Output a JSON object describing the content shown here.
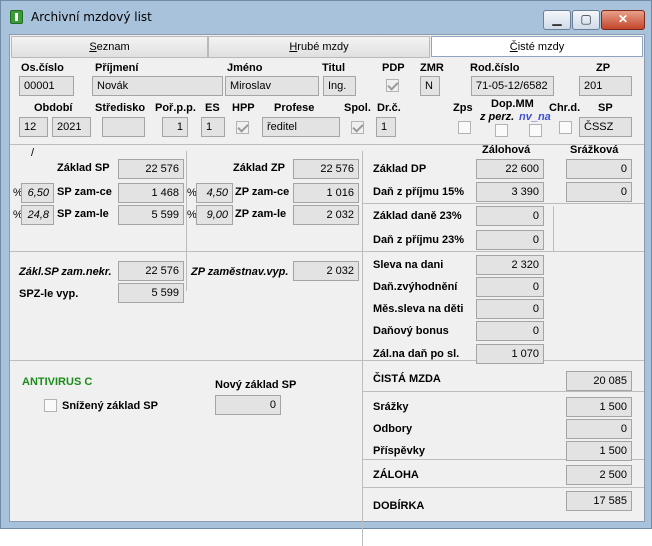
{
  "window": {
    "title": "Archivní mzdový list"
  },
  "tabs": [
    "Seznam",
    "Hrubé mzdy",
    "Čisté mzdy"
  ],
  "tabs_underline": [
    "S",
    "H",
    "Č"
  ],
  "tabs_rest": [
    "eznam",
    "rubé mzdy",
    "isté mzdy"
  ],
  "header": {
    "os_cislo": {
      "label": "Os.číslo",
      "value": "00001"
    },
    "prijmeni": {
      "label": "Příjmení",
      "value": "Novák"
    },
    "jmeno": {
      "label": "Jméno",
      "value": "Miroslav"
    },
    "titul": {
      "label": "Titul",
      "value": "Ing."
    },
    "pdp": {
      "label": "PDP",
      "checked": true
    },
    "zmr": {
      "label": "ZMR",
      "value": "N"
    },
    "rod_cislo": {
      "label": "Rod.číslo",
      "value": "71-05-12/6582"
    },
    "zp": {
      "label": "ZP",
      "value": "201"
    },
    "obdobi": {
      "label": "Období",
      "month": "12",
      "year": "2021"
    },
    "stredisko": {
      "label": "Středisko",
      "value": ""
    },
    "por_pp": {
      "label": "Poř.p.p.",
      "value": "1"
    },
    "es": {
      "label": "ES",
      "value": "1"
    },
    "hpp": {
      "label": "HPP",
      "checked": true
    },
    "profese": {
      "label": "Profese",
      "value": "ředitel"
    },
    "spol": {
      "label": "Spol.",
      "checked": true
    },
    "dr_c": {
      "label": "Dr.č.",
      "value": "1"
    },
    "zps": {
      "label": "Zps",
      "checked": false
    },
    "dop_mm": {
      "label": "Dop.MM",
      "sub_label": "z perz.",
      "sub_value": "nv_na",
      "checked": false
    },
    "chr_d": {
      "label": "Chr.d.",
      "checked": false
    },
    "sp": {
      "label": "SP",
      "value": "ČSSZ"
    }
  },
  "social": {
    "marker": "/",
    "zaklad_sp": {
      "label": "Základ SP",
      "value": "22 576"
    },
    "sp_zam_ce": {
      "label": "SP zam-ce",
      "pct": "6,50",
      "value": "1 468"
    },
    "sp_zam_le": {
      "label": "SP zam-le",
      "pct": "24,8",
      "value": "5 599"
    },
    "pct_sign": "%",
    "zakl_sp_zam_nekr": {
      "label": "Zákl.SP zam.nekr.",
      "value": "22 576"
    },
    "spz_le_vyp": {
      "label": "SPZ-le vyp.",
      "value": "5 599"
    }
  },
  "health": {
    "zaklad_zp": {
      "label": "Základ ZP",
      "value": "22 576"
    },
    "zp_zam_ce": {
      "label": "ZP zam-ce",
      "pct": "4,50",
      "value": "1 016"
    },
    "zp_zam_le": {
      "label": "ZP zam-le",
      "pct": "9,00",
      "value": "2 032"
    },
    "zp_zamestnav_vyp": {
      "label": "ZP zaměstnav.vyp.",
      "value": "2 032"
    }
  },
  "tax": {
    "col_zalohova": "Zálohová",
    "col_srazkova": "Srážková",
    "zaklad_dp": {
      "label": "Základ DP",
      "zal": "22 600",
      "sraz": "0"
    },
    "dan_15": {
      "label": "Daň z příjmu 15%",
      "zal": "3 390",
      "sraz": "0"
    },
    "zaklad_dane_23": {
      "label": "Základ daně 23%",
      "value": "0"
    },
    "dan_23": {
      "label": "Daň z příjmu 23%",
      "value": "0"
    },
    "sleva_na_dani": {
      "label": "Sleva na dani",
      "value": "2 320"
    },
    "dan_zvyhodneni": {
      "label": "Daň.zvýhodnění",
      "value": "0"
    },
    "mes_sleva": {
      "label": "Měs.sleva na děti",
      "value": "0"
    },
    "danovy_bonus": {
      "label": "Daňový bonus",
      "value": "0"
    },
    "zal_na_dan": {
      "label": "Zál.na daň po sl.",
      "value": "1 070"
    }
  },
  "antivirus": {
    "title": "ANTIVIRUS C",
    "snizeny": "Snížený základ SP",
    "novy_label": "Nový základ SP",
    "novy_value": "0"
  },
  "summary": {
    "cista_mzda": {
      "label": "ČISTÁ MZDA",
      "value": "20 085"
    },
    "srazky": {
      "label": "Srážky",
      "value": "1 500"
    },
    "odbory": {
      "label": "Odbory",
      "value": "0"
    },
    "prispevky": {
      "label": "Příspěvky",
      "value": "1 500"
    },
    "zaloha": {
      "label": "ZÁLOHA",
      "value": "2 500"
    },
    "dobirka": {
      "label": "DOBÍRKA",
      "value": "17 585"
    }
  }
}
